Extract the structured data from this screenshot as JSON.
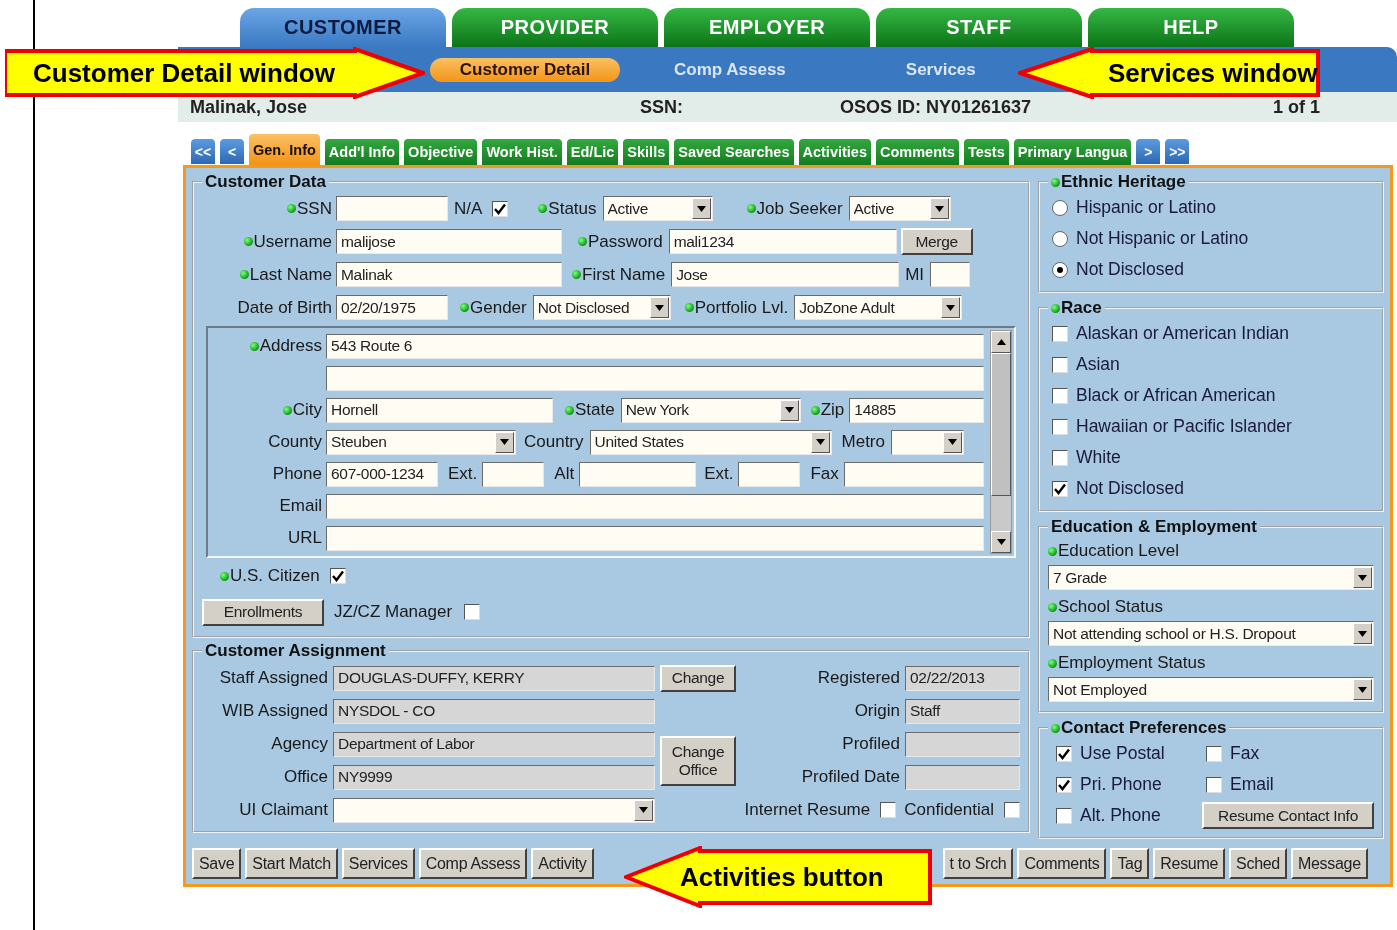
{
  "main_tabs": [
    {
      "label": "CUSTOMER",
      "selected": true
    },
    {
      "label": "PROVIDER",
      "selected": false
    },
    {
      "label": "EMPLOYER",
      "selected": false
    },
    {
      "label": "STAFF",
      "selected": false
    },
    {
      "label": "HELP",
      "selected": false
    }
  ],
  "sub_nav": [
    {
      "label": "Customer Detail",
      "selected": true
    },
    {
      "label": "Comp Assess",
      "selected": false
    },
    {
      "label": "Services",
      "selected": false
    }
  ],
  "header": {
    "name": "Malinak, Jose",
    "ssn": "SSN:",
    "osos_id": "OSOS ID: NY01261637",
    "record": "1 of 1"
  },
  "page_tabs": {
    "first": "<<",
    "prev": "<",
    "next": ">",
    "last": ">>",
    "items": [
      {
        "label": "Gen. Info",
        "selected": true
      },
      {
        "label": "Add'l Info",
        "selected": false
      },
      {
        "label": "Objective",
        "selected": false
      },
      {
        "label": "Work Hist.",
        "selected": false
      },
      {
        "label": "Ed/Lic",
        "selected": false
      },
      {
        "label": "Skills",
        "selected": false
      },
      {
        "label": "Saved Searches",
        "selected": false
      },
      {
        "label": "Activities",
        "selected": false
      },
      {
        "label": "Comments",
        "selected": false
      },
      {
        "label": "Tests",
        "selected": false
      },
      {
        "label": "Primary Langua",
        "selected": false
      }
    ]
  },
  "customer_data": {
    "title": "Customer Data",
    "rows": [
      {
        "items": [
          {
            "kind": "label",
            "text": "SSN",
            "required": true
          },
          {
            "kind": "input"
          },
          {
            "kind": "label",
            "text": "N/A",
            "required": false
          },
          {
            "kind": "checkbox",
            "checked": true
          },
          {
            "kind": "label",
            "text": "Status",
            "required": true
          },
          {
            "kind": "select",
            "value": "Active"
          },
          {
            "kind": "label",
            "text": "Job Seeker",
            "required": true
          },
          {
            "kind": "select",
            "value": "Active"
          }
        ]
      },
      {
        "items": [
          {
            "kind": "label",
            "text": "Username",
            "required": true
          },
          {
            "kind": "input",
            "value": "malijose"
          },
          {
            "kind": "label",
            "text": "Password",
            "required": true
          },
          {
            "kind": "input",
            "value": "mali1234"
          },
          {
            "kind": "button",
            "label": "Merge"
          }
        ]
      },
      {
        "items": [
          {
            "kind": "label",
            "text": "Last Name",
            "required": true
          },
          {
            "kind": "input",
            "value": "Malinak"
          },
          {
            "kind": "label",
            "text": "First Name",
            "required": true
          },
          {
            "kind": "input",
            "value": "Jose"
          },
          {
            "kind": "label",
            "text": "MI",
            "required": false
          },
          {
            "kind": "input"
          }
        ]
      },
      {
        "items": [
          {
            "kind": "label",
            "text": "Date of Birth",
            "required": false
          },
          {
            "kind": "input",
            "value": "02/20/1975"
          },
          {
            "kind": "label",
            "text": "Gender",
            "required": true
          },
          {
            "kind": "select",
            "value": "Not Disclosed"
          },
          {
            "kind": "label",
            "text": "Portfolio Lvl.",
            "required": true
          },
          {
            "kind": "select",
            "value": "JobZone Adult"
          }
        ]
      }
    ],
    "address_rows": [
      {
        "items": [
          {
            "kind": "label",
            "text": "Address",
            "required": true
          },
          {
            "kind": "input",
            "value": "543 Route 6"
          }
        ]
      },
      {
        "items": [
          {
            "kind": "input"
          }
        ]
      },
      {
        "items": [
          {
            "kind": "label",
            "text": "City",
            "required": true
          },
          {
            "kind": "input",
            "value": "Hornell"
          },
          {
            "kind": "label",
            "text": "State",
            "required": true
          },
          {
            "kind": "select",
            "value": "New York"
          },
          {
            "kind": "label",
            "text": "Zip",
            "required": true
          },
          {
            "kind": "input",
            "value": "14885"
          }
        ]
      },
      {
        "items": [
          {
            "kind": "label",
            "text": "County",
            "required": false
          },
          {
            "kind": "select",
            "value": "Steuben"
          },
          {
            "kind": "label",
            "text": "Country",
            "required": false
          },
          {
            "kind": "select",
            "value": "United States"
          },
          {
            "kind": "label",
            "text": "Metro",
            "required": false
          },
          {
            "kind": "select"
          }
        ]
      },
      {
        "items": [
          {
            "kind": "label",
            "text": "Phone",
            "required": false
          },
          {
            "kind": "input",
            "value": "607-000-1234"
          },
          {
            "kind": "label",
            "text": "Ext.",
            "required": false
          },
          {
            "kind": "input"
          },
          {
            "kind": "label",
            "text": "Alt",
            "required": false
          },
          {
            "kind": "input"
          },
          {
            "kind": "label",
            "text": "Ext.",
            "required": false
          },
          {
            "kind": "input"
          },
          {
            "kind": "label",
            "text": "Fax",
            "required": false
          },
          {
            "kind": "input"
          }
        ]
      },
      {
        "items": [
          {
            "kind": "label",
            "text": "Email",
            "required": false
          },
          {
            "kind": "input"
          }
        ]
      },
      {
        "items": [
          {
            "kind": "label",
            "text": "URL",
            "required": false
          },
          {
            "kind": "input"
          }
        ]
      }
    ],
    "citizen": {
      "label": "U.S. Citizen",
      "required": true,
      "checked": true
    },
    "enrollments": "Enrollments",
    "manager": {
      "label": "JZ/CZ Manager",
      "checked": false
    }
  },
  "customer_assignment": {
    "title": "Customer Assignment",
    "left": [
      {
        "label": "Staff Assigned",
        "value": "DOUGLAS-DUFFY, KERRY"
      },
      {
        "label": "WIB Assigned",
        "value": "NYSDOL - CO"
      },
      {
        "label": "Agency",
        "value": "Department of Labor"
      },
      {
        "label": "Office",
        "value": "NY9999"
      }
    ],
    "buttons": [
      "Change",
      "Change Office"
    ],
    "right": [
      {
        "label": "Registered",
        "value": "02/22/2013"
      },
      {
        "label": "Origin",
        "value": "Staff"
      },
      {
        "label": "Profiled"
      },
      {
        "label": "Profiled Date"
      }
    ],
    "ui_claimant": {
      "label": "UI Claimant"
    },
    "flags": [
      {
        "label": "Internet Resume",
        "checked": false
      },
      {
        "label": "Confidential",
        "checked": false
      }
    ]
  },
  "ethnic_heritage": {
    "title": "Ethnic Heritage",
    "required": true,
    "options": [
      {
        "label": "Hispanic or Latino",
        "selected": false
      },
      {
        "label": "Not Hispanic or Latino",
        "selected": false
      },
      {
        "label": "Not Disclosed",
        "selected": true
      }
    ]
  },
  "race": {
    "title": "Race",
    "required": true,
    "options": [
      {
        "label": "Alaskan or American Indian",
        "checked": false
      },
      {
        "label": "Asian",
        "checked": false
      },
      {
        "label": "Black or African American",
        "checked": false
      },
      {
        "label": "Hawaiian or Pacific Islander",
        "checked": false
      },
      {
        "label": "White",
        "checked": false
      },
      {
        "label": "Not Disclosed",
        "checked": true
      }
    ]
  },
  "education_employment": {
    "title": "Education & Employment",
    "fields": [
      {
        "label": "Education Level",
        "required": true,
        "value": "7 Grade"
      },
      {
        "label": "School Status",
        "required": true,
        "value": "Not attending school or H.S. Dropout"
      },
      {
        "label": "Employment Status",
        "required": true,
        "value": "Not Employed"
      }
    ]
  },
  "contact_preferences": {
    "title": "Contact Preferences",
    "required": true,
    "options": [
      {
        "label": "Use Postal",
        "checked": true
      },
      {
        "label": "Fax",
        "checked": false
      },
      {
        "label": "Pri. Phone",
        "checked": true
      },
      {
        "label": "Email",
        "checked": false
      },
      {
        "label": "Alt. Phone",
        "checked": false
      }
    ],
    "button": "Resume Contact Info"
  },
  "toolbar": [
    "Save",
    "Start Match",
    "Services",
    "Comp Assess",
    "Activity",
    "t to Srch",
    "Comments",
    "Tag",
    "Resume",
    "Sched",
    "Message"
  ],
  "callouts": [
    {
      "text": "Customer Detail window"
    },
    {
      "text": "Services window"
    },
    {
      "text": "Activities button"
    }
  ]
}
